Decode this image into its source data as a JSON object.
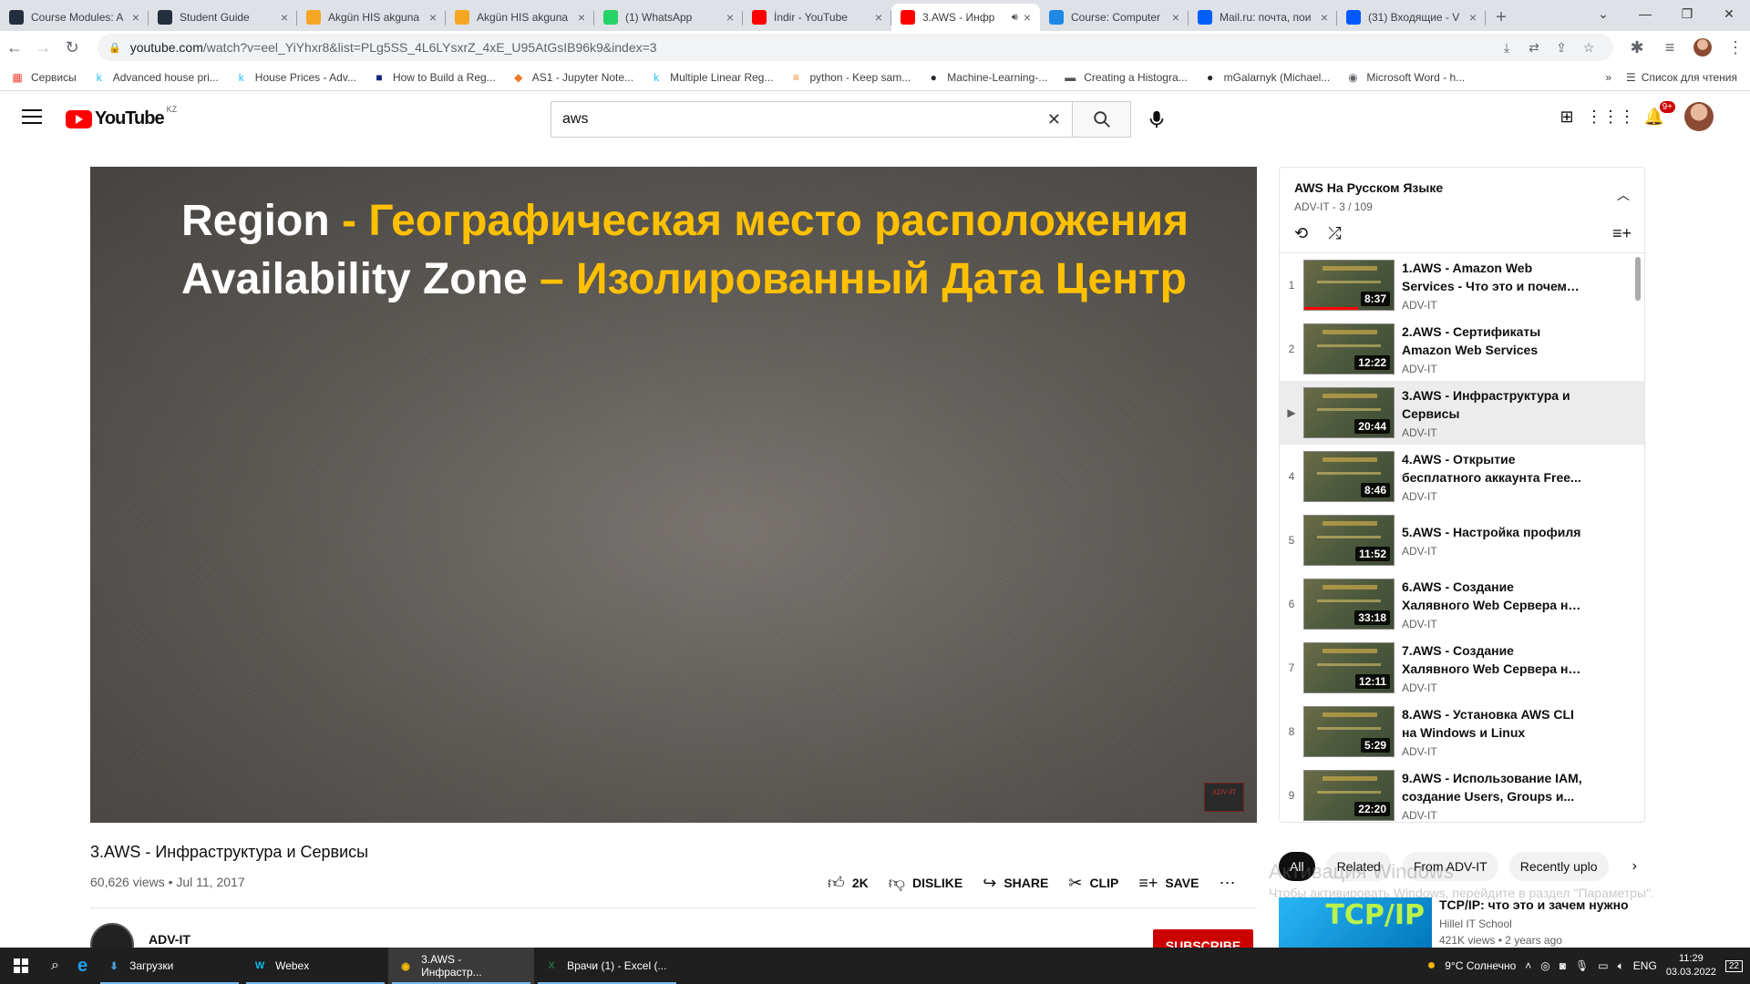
{
  "browser": {
    "tabs": [
      {
        "title": "Course Modules: A",
        "fav_color": "#232f3e"
      },
      {
        "title": "Student Guide",
        "fav_color": "#232f3e"
      },
      {
        "title": "Akgün HIS akguna",
        "fav_color": "#f5a623"
      },
      {
        "title": "Akgün HIS akguna",
        "fav_color": "#f5a623"
      },
      {
        "title": "(1) WhatsApp",
        "fav_color": "#25d366"
      },
      {
        "title": "İndir - YouTube",
        "fav_color": "#ff0000"
      },
      {
        "title": "3.AWS - Инфр",
        "fav_color": "#ff0000",
        "active": true
      },
      {
        "title": "Course: Computer",
        "fav_color": "#1e88e5"
      },
      {
        "title": "Mail.ru: почта, пои",
        "fav_color": "#005ff9"
      },
      {
        "title": "(31) Входящие - V",
        "fav_color": "#0058ff"
      }
    ],
    "url_host": "youtube.com",
    "url_rest": "/watch?v=eel_YiYhxr8&list=PLg5SS_4L6LYsxrZ_4xE_U95AtGsIB96k9&index=3",
    "bookmarks": [
      {
        "label": "Сервисы",
        "icon": "apps-icon",
        "glyph": "▦",
        "color": "#ea4335"
      },
      {
        "label": "Advanced house pri...",
        "icon": "kaggle-icon",
        "glyph": "k",
        "color": "#20beff"
      },
      {
        "label": "House Prices - Adv...",
        "icon": "kaggle-icon",
        "glyph": "k",
        "color": "#20beff"
      },
      {
        "label": "How to Build a Reg...",
        "icon": "site-icon",
        "glyph": "■",
        "color": "#1a237e"
      },
      {
        "label": "AS1 - Jupyter Note...",
        "icon": "jupyter-icon",
        "glyph": "◆",
        "color": "#f37626"
      },
      {
        "label": "Multiple Linear Reg...",
        "icon": "kaggle-icon",
        "glyph": "k",
        "color": "#20beff"
      },
      {
        "label": "python - Keep sam...",
        "icon": "stackoverflow-icon",
        "glyph": "≡",
        "color": "#f48024"
      },
      {
        "label": "Machine-Learning-...",
        "icon": "github-icon",
        "glyph": "●",
        "color": "#24292e"
      },
      {
        "label": "Creating a Histogra...",
        "icon": "site-icon",
        "glyph": "▬",
        "color": "#555555"
      },
      {
        "label": "mGalarnyk (Michael...",
        "icon": "github-icon",
        "glyph": "●",
        "color": "#24292e"
      },
      {
        "label": "Microsoft Word - h...",
        "icon": "globe-icon",
        "glyph": "◉",
        "color": "#5f6368"
      }
    ],
    "reading_list": "Список для чтения"
  },
  "youtube": {
    "country": "KZ",
    "logo_text": "YouTube",
    "search_value": "aws",
    "notification_count": "9+"
  },
  "video": {
    "slide_line1_white": "Region",
    "slide_line1_yellow": " -  Географическая место расположения",
    "slide_line2_white": "Availability Zone",
    "slide_line2_yellow": " – Изолированный Дата Центр",
    "watermark": "ADV-IT",
    "title": "3.AWS - Инфраструктура и Сервисы",
    "meta": "60,626 views • Jul 11, 2017",
    "likes": "2K",
    "dislike": "DISLIKE",
    "share": "SHARE",
    "clip": "CLIP",
    "save": "SAVE",
    "channel": "ADV-IT",
    "subscribe": "SUBSCRIBE"
  },
  "playlist": {
    "title": "AWS На Русском Языке",
    "sub": "ADV-IT - 3 / 109",
    "items": [
      {
        "num": "1",
        "title": "1.AWS - Amazon Web Services - Что это и почему тебе это...",
        "duration": "8:37",
        "channel": "ADV-IT",
        "watched": true
      },
      {
        "num": "2",
        "title": "2.AWS - Сертификаты Amazon Web Services",
        "duration": "12:22",
        "channel": "ADV-IT"
      },
      {
        "num": "▶",
        "title": "3.AWS - Инфраструктура и Сервисы",
        "duration": "20:44",
        "channel": "ADV-IT",
        "current": true
      },
      {
        "num": "4",
        "title": "4.AWS - Открытие бесплатного аккаунта Free...",
        "duration": "8:46",
        "channel": "ADV-IT"
      },
      {
        "num": "5",
        "title": "5.AWS - Настройка профиля",
        "duration": "11:52",
        "channel": "ADV-IT"
      },
      {
        "num": "6",
        "title": "6.AWS - Создание Халявного Web Сервера на базе...",
        "duration": "33:18",
        "channel": "ADV-IT"
      },
      {
        "num": "7",
        "title": "7.AWS - Создание Халявного Web Сервера на базе Linux...",
        "duration": "12:11",
        "channel": "ADV-IT"
      },
      {
        "num": "8",
        "title": "8.AWS - Установка AWS CLI на Windows и Linux",
        "duration": "5:29",
        "channel": "ADV-IT"
      },
      {
        "num": "9",
        "title": "9.AWS - Использование IAM, создание Users, Groups и...",
        "duration": "22:20",
        "channel": "ADV-IT"
      }
    ]
  },
  "chips": [
    "All",
    "Related",
    "From ADV-IT",
    "Recently uplo"
  ],
  "windows_activation": {
    "title": "Активация Windows",
    "text": "Чтобы активировать Windows, перейдите в раздел \"Параметры\"."
  },
  "recommendation": {
    "thumb_text": "TCP/IP",
    "title": "TCP/IP: что это и зачем нужно",
    "channel": "Hillel IT School",
    "views": "421K views • 2 years ago"
  },
  "taskbar": {
    "apps": [
      {
        "label": "Загрузки",
        "icon": "downloads-icon",
        "glyph": "⬇",
        "color": "#4aa3df"
      },
      {
        "label": "Webex",
        "icon": "webex-icon",
        "glyph": "W",
        "color": "#00bceb"
      },
      {
        "label": "3.AWS - Инфрастр...",
        "icon": "chrome-icon",
        "glyph": "◉",
        "color": "#fbbc04",
        "active": true
      },
      {
        "label": "Врачи (1) - Excel (...",
        "icon": "excel-icon",
        "glyph": "X",
        "color": "#1d6f42"
      }
    ],
    "weather": "9°C  Солнечно",
    "lang": "ENG",
    "time": "11:29",
    "date": "03.03.2022",
    "notif_count": "22"
  }
}
